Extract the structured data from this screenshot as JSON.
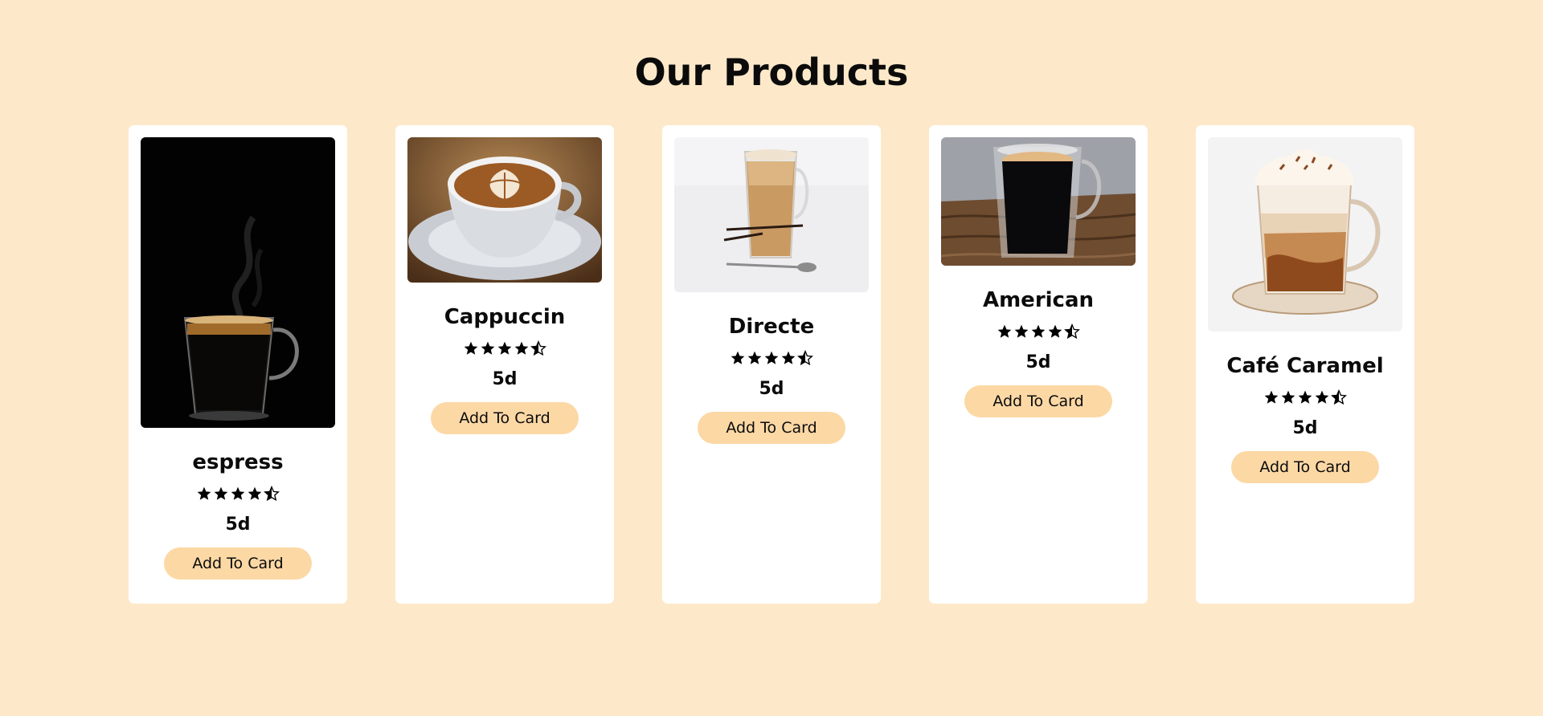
{
  "page": {
    "title": "Our Products",
    "background_color": "#fde9c9",
    "accent_color": "#fcd8a5"
  },
  "products": [
    {
      "name": "espress",
      "price": "5d",
      "rating": 4.5,
      "button_label": "Add To Card",
      "image": "espresso-steam-glass-photo"
    },
    {
      "name": "Cappuccin",
      "price": "5d",
      "rating": 4.5,
      "button_label": "Add To Card",
      "image": "cappuccino-latte-art-cup-photo"
    },
    {
      "name": "Directe",
      "price": "5d",
      "rating": 4.5,
      "button_label": "Add To Card",
      "image": "latte-tall-glass-photo"
    },
    {
      "name": "American",
      "price": "5d",
      "rating": 4.5,
      "button_label": "Add To Card",
      "image": "americano-glass-mug-photo"
    },
    {
      "name": "Café Caramel",
      "price": "5d",
      "rating": 4.5,
      "button_label": "Add To Card",
      "image": "caramel-coffee-illustration"
    }
  ]
}
